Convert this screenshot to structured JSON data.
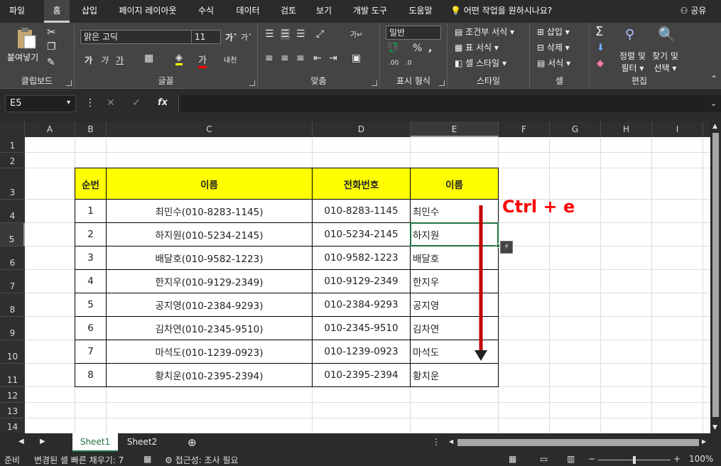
{
  "menu": {
    "file": "파일",
    "home": "홈",
    "insert": "삽입",
    "layout": "페이지 레이아웃",
    "formulas": "수식",
    "data": "데이터",
    "review": "검토",
    "view": "보기",
    "developer": "개발 도구",
    "help": "도움말",
    "tell_me": "어떤 작업을 원하시나요?",
    "share": "공유"
  },
  "ribbon": {
    "clipboard": {
      "paste": "붙여넣기",
      "label": "클립보드"
    },
    "font": {
      "name": "맑은 고딕",
      "size": "11",
      "label": "글꼴"
    },
    "alignment": {
      "label": "맞춤"
    },
    "number": {
      "format": "일반",
      "label": "표시 형식"
    },
    "styles": {
      "conditional": "조건부 서식",
      "table": "표 서식",
      "cell": "셀 스타일",
      "label": "스타일"
    },
    "cells": {
      "insert": "삽입",
      "delete": "삭제",
      "format": "서식",
      "label": "셀"
    },
    "editing": {
      "sort": "정렬 및",
      "sort2": "필터",
      "find": "찾기 및",
      "find2": "선택",
      "label": "편집"
    }
  },
  "formula_bar": {
    "name_box": "E5",
    "fx": "fx",
    "value": ""
  },
  "columns": [
    "A",
    "B",
    "C",
    "D",
    "E",
    "F",
    "G",
    "H",
    "I"
  ],
  "selected_column": "E",
  "rows": [
    "1",
    "2",
    "3",
    "4",
    "5",
    "6",
    "7",
    "8",
    "9",
    "10",
    "11",
    "12",
    "13",
    "14"
  ],
  "selected_row": "5",
  "table": {
    "headers": [
      "순번",
      "이름",
      "전화번호",
      "이름"
    ],
    "rows": [
      [
        "1",
        "최민수(010-8283-1145)",
        "010-8283-1145",
        "최민수"
      ],
      [
        "2",
        "하지원(010-5234-2145)",
        "010-5234-2145",
        "하지원"
      ],
      [
        "3",
        "배달호(010-9582-1223)",
        "010-9582-1223",
        "배달호"
      ],
      [
        "4",
        "한지우(010-9129-2349)",
        "010-9129-2349",
        "한지우"
      ],
      [
        "5",
        "공지영(010-2384-9293)",
        "010-2384-9293",
        "공지영"
      ],
      [
        "6",
        "김차연(010-2345-9510)",
        "010-2345-9510",
        "김차연"
      ],
      [
        "7",
        "마석도(010-1239-0923)",
        "010-1239-0923",
        "마석도"
      ],
      [
        "8",
        "황치운(010-2395-2394)",
        "010-2395-2394",
        "황치운"
      ]
    ]
  },
  "annotation": {
    "text": "Ctrl + e",
    "color": "#ff0000"
  },
  "sheets": [
    "Sheet1",
    "Sheet2"
  ],
  "active_sheet": "Sheet1",
  "status": {
    "ready": "준비",
    "flash_fill": "변경된 셀 빠른 채우기: 7",
    "accessibility": "접근성: 조사 필요",
    "zoom": "100%"
  }
}
